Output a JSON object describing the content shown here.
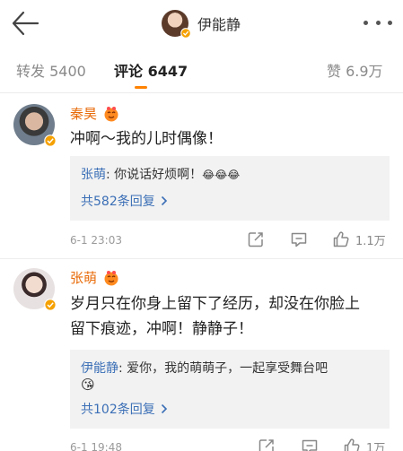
{
  "header": {
    "title": "伊能静",
    "back_icon": "arrow-left-icon",
    "more_icon": "more-dots-icon"
  },
  "tabs": [
    {
      "label": "转发 5400",
      "active": false
    },
    {
      "label": "评论 6447",
      "active": true
    },
    {
      "label": "赞 6.9万",
      "active": false
    }
  ],
  "comments": [
    {
      "author": "秦昊",
      "text": "冲啊～我的儿时偶像！",
      "reply": {
        "author": "张萌",
        "separator": ": ",
        "text": "你说话好烦啊！",
        "emoji": "😂😂😂"
      },
      "more_replies": "共582条回复",
      "time": "6-1 23:03",
      "likes": "1.1万"
    },
    {
      "author": "张萌",
      "text_line1": "岁月只在你身上留下了经历，却没在你脸上",
      "text_line2": "留下痕迹，冲啊！静静子！",
      "reply": {
        "author": "伊能静",
        "separator": ": ",
        "text": "爱你，我的萌萌子，一起享受舞台吧",
        "emoji": "😘"
      },
      "more_replies": "共102条回复",
      "time": "6-1 19:48",
      "likes": "1万"
    }
  ],
  "colors": {
    "accent": "#ff8200",
    "name": "#e86b0a",
    "link": "#3b6fb6",
    "verified": "#f5a100"
  }
}
